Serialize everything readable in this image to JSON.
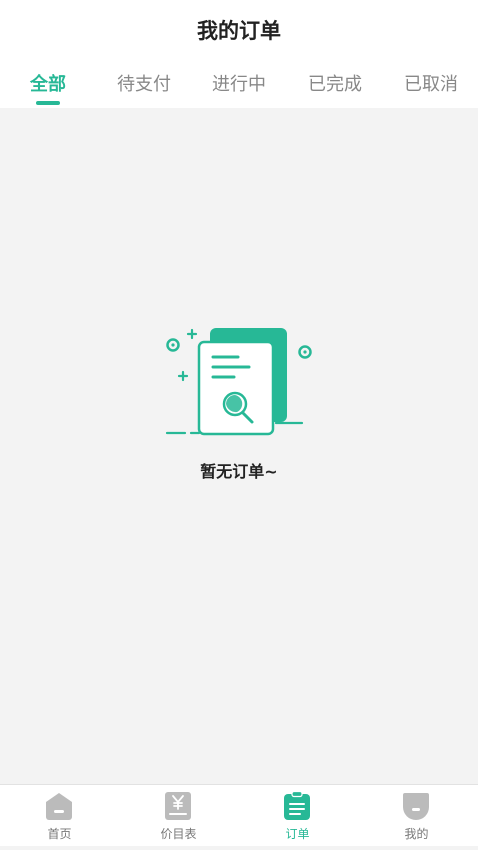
{
  "header": {
    "title": "我的订单"
  },
  "tabs": [
    {
      "label": "全部",
      "active": true
    },
    {
      "label": "待支付",
      "active": false
    },
    {
      "label": "进行中",
      "active": false
    },
    {
      "label": "已完成",
      "active": false
    },
    {
      "label": "已取消",
      "active": false
    }
  ],
  "empty_state": {
    "message": "暂无订单~"
  },
  "bottom_nav": [
    {
      "label": "首页",
      "icon": "home-icon",
      "active": false
    },
    {
      "label": "价目表",
      "icon": "price-list-icon",
      "active": false
    },
    {
      "label": "订单",
      "icon": "order-clipboard-icon",
      "active": true
    },
    {
      "label": "我的",
      "icon": "profile-icon",
      "active": false
    }
  ],
  "colors": {
    "accent": "#27b896",
    "inactive_icon": "#bbbbbb",
    "background": "#f3f3f3"
  }
}
